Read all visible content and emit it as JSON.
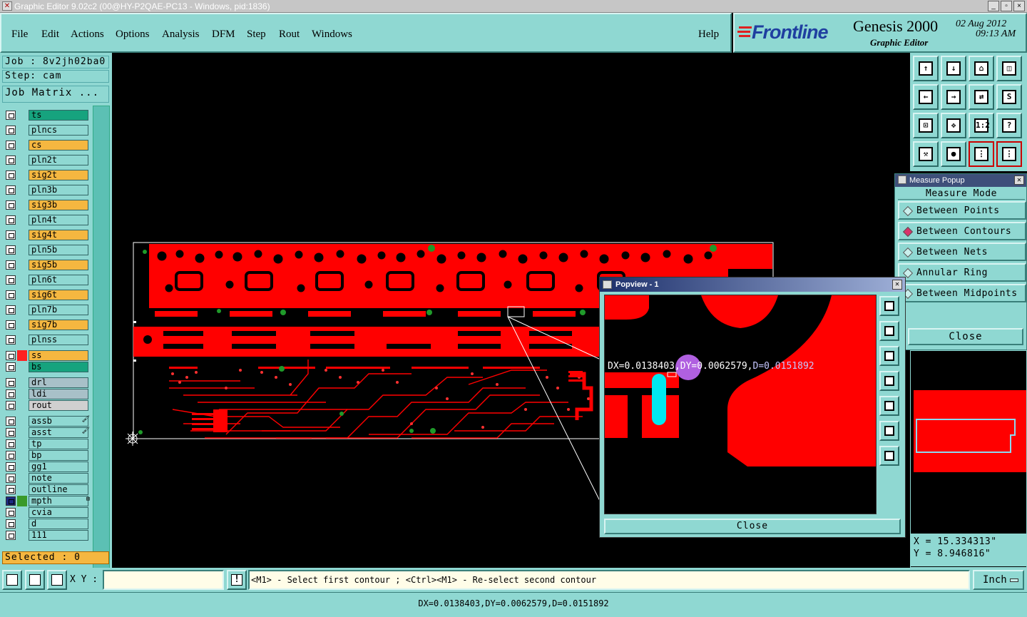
{
  "window": {
    "title": "Graphic Editor 9.02c2 (00@HY-P2QAE-PC13 - Windows, pid:1836)",
    "icon": "x-app-icon",
    "controls": [
      "_",
      "▫",
      "×"
    ]
  },
  "menu": {
    "items": [
      "File",
      "Edit",
      "Actions",
      "Options",
      "Analysis",
      "DFM",
      "Step",
      "Rout",
      "Windows"
    ],
    "help": "Help"
  },
  "brand": {
    "logo": "Frontline",
    "product": "Genesis 2000",
    "subtitle": "Graphic Editor",
    "date": "02 Aug 2012",
    "time": "09:13 AM"
  },
  "job": {
    "job_label": "Job : 8v2jh02ba0",
    "step_label": "Step: cam",
    "matrix_button": "Job Matrix ..."
  },
  "layers": [
    {
      "name": "ts",
      "color": "#16a37e"
    },
    {
      "name": "plncs",
      "color": "#8fd8d2"
    },
    {
      "name": "cs",
      "color": "#f5b740"
    },
    {
      "name": "pln2t",
      "color": "#8fd8d2"
    },
    {
      "name": "sig2t",
      "color": "#f5b740"
    },
    {
      "name": "pln3b",
      "color": "#8fd8d2"
    },
    {
      "name": "sig3b",
      "color": "#f5b740"
    },
    {
      "name": "pln4t",
      "color": "#8fd8d2"
    },
    {
      "name": "sig4t",
      "color": "#f5b740"
    },
    {
      "name": "pln5b",
      "color": "#8fd8d2"
    },
    {
      "name": "sig5b",
      "color": "#f5b740"
    },
    {
      "name": "pln6t",
      "color": "#8fd8d2"
    },
    {
      "name": "sig6t",
      "color": "#f5b740"
    },
    {
      "name": "pln7b",
      "color": "#8fd8d2"
    },
    {
      "name": "sig7b",
      "color": "#f5b740"
    },
    {
      "name": "plnss",
      "color": "#8fd8d2"
    },
    {
      "name": "ss",
      "color": "#f5b740",
      "swatch": "#ff2020"
    },
    {
      "name": "bs",
      "color": "#16a37e"
    },
    {
      "name": "drl",
      "color": "#a8c0c8"
    },
    {
      "name": "ldi",
      "color": "#a8c0c8"
    },
    {
      "name": "rout",
      "color": "#d0d0d0"
    },
    {
      "name": "assb",
      "color": "#8fd8d2",
      "mark": "🖌"
    },
    {
      "name": "asst",
      "color": "#8fd8d2",
      "mark": "🖌"
    },
    {
      "name": "tp",
      "color": "#8fd8d2"
    },
    {
      "name": "bp",
      "color": "#8fd8d2"
    },
    {
      "name": "gg1",
      "color": "#8fd8d2"
    },
    {
      "name": "note",
      "color": "#8fd8d2"
    },
    {
      "name": "outline",
      "color": "#8fd8d2"
    },
    {
      "name": "mpth",
      "color": "#8fd8d2",
      "swatch": "#3a9a2a",
      "mark": "⊞",
      "active": true
    },
    {
      "name": "cvia",
      "color": "#8fd8d2"
    },
    {
      "name": "d",
      "color": "#8fd8d2"
    },
    {
      "name": "111",
      "color": "#8fd8d2"
    }
  ],
  "selected": "Selected : 0",
  "measure": {
    "title": "Measure Popup",
    "mode_label": "Measure Mode",
    "options": [
      "Between Points",
      "Between Contours",
      "Between Nets",
      "Annular Ring",
      "Between Midpoints"
    ],
    "selected_option": "Between Contours",
    "close": "Close"
  },
  "popview": {
    "title": "Popview - 1",
    "measure_text_dx": "DX=0.0138403,",
    "measure_text_dy": "DY=0.0062579,",
    "measure_text_d": "D=0.0151892",
    "close": "Close"
  },
  "coords": {
    "x": "X = 15.334313\"",
    "y": "Y = 8.946816\""
  },
  "statusbar": {
    "xy_label": "X Y :",
    "xy_value": "",
    "prompt": "<M1> - Select first contour ; <Ctrl><M1> - Re-select second contour",
    "units": "Inch",
    "result": "DX=0.0138403,DY=0.0062579,D=0.0151892"
  },
  "colors": {
    "panel": "#8fd8d2",
    "copper": "#ff0000",
    "cyan_feature": "#00e8f0",
    "measure_marker": "#b060e0"
  }
}
